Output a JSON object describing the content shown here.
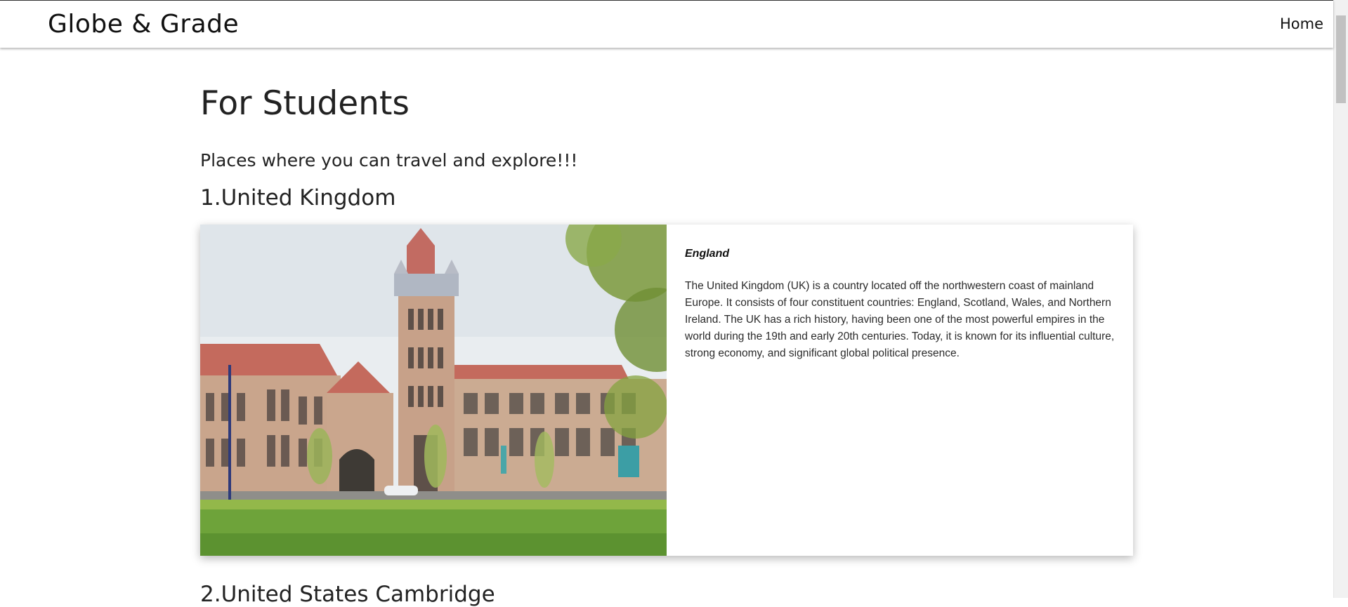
{
  "navbar": {
    "brand": "Globe & Grade",
    "home_label": "Home"
  },
  "page": {
    "title": "For Students",
    "subtitle": "Places where you can travel and explore!!!"
  },
  "sections": [
    {
      "heading": "1.United Kingdom",
      "card": {
        "country": "England",
        "description": "The United Kingdom (UK) is a country located off the northwestern coast of mainland Europe. It consists of four constituent countries: England, Scotland, Wales, and Northern Ireland. The UK has a rich history, having been one of the most powerful empires in the world during the 19th and early 20th centuries. Today, it is known for its influential culture, strong economy, and significant global political presence."
      }
    },
    {
      "heading": "2.United States Cambridge"
    }
  ],
  "colors": {
    "text": "#222222",
    "roof": "#c96a5e",
    "stone": "#c9a48a",
    "grass": "#6ea33a",
    "sky": "#e8ecef"
  }
}
